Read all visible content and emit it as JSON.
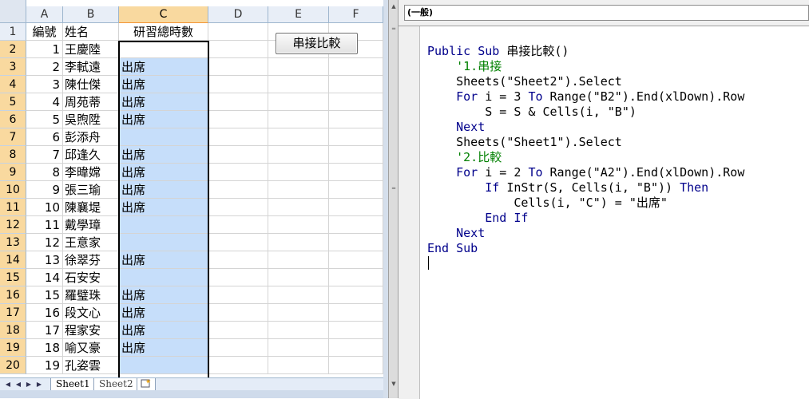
{
  "excel": {
    "columns": [
      "A",
      "B",
      "C",
      "D",
      "E",
      "F"
    ],
    "active_column": "C",
    "header_row": {
      "a": "編號",
      "b": "姓名",
      "c": "研習總時數"
    },
    "rows": [
      {
        "row": "2",
        "num": "1",
        "name": "王慶陸",
        "c": ""
      },
      {
        "row": "3",
        "num": "2",
        "name": "李軾遠",
        "c": "出席"
      },
      {
        "row": "4",
        "num": "3",
        "name": "陳仕傑",
        "c": "出席"
      },
      {
        "row": "5",
        "num": "4",
        "name": "周苑蒂",
        "c": "出席"
      },
      {
        "row": "6",
        "num": "5",
        "name": "吳煦陞",
        "c": "出席"
      },
      {
        "row": "7",
        "num": "6",
        "name": "彭添舟",
        "c": ""
      },
      {
        "row": "8",
        "num": "7",
        "name": "邱逢久",
        "c": "出席"
      },
      {
        "row": "9",
        "num": "8",
        "name": "李暐嫦",
        "c": "出席"
      },
      {
        "row": "10",
        "num": "9",
        "name": "張三瑜",
        "c": "出席"
      },
      {
        "row": "11",
        "num": "10",
        "name": "陳襄堤",
        "c": "出席"
      },
      {
        "row": "12",
        "num": "11",
        "name": "戴學璋",
        "c": ""
      },
      {
        "row": "13",
        "num": "12",
        "name": "王意家",
        "c": ""
      },
      {
        "row": "14",
        "num": "13",
        "name": "徐翠芬",
        "c": "出席"
      },
      {
        "row": "15",
        "num": "14",
        "name": "石安安",
        "c": ""
      },
      {
        "row": "16",
        "num": "15",
        "name": "羅璧珠",
        "c": "出席"
      },
      {
        "row": "17",
        "num": "16",
        "name": "段文心",
        "c": "出席"
      },
      {
        "row": "18",
        "num": "17",
        "name": "程家安",
        "c": "出席"
      },
      {
        "row": "19",
        "num": "18",
        "name": "喻又豪",
        "c": "出席"
      },
      {
        "row": "20",
        "num": "19",
        "name": "孔姿雲",
        "c": ""
      }
    ],
    "button_label": "串接比較",
    "sheet_tabs": [
      "Sheet1",
      "Sheet2"
    ],
    "selection_color": "#c6defa"
  },
  "vbe": {
    "procedure_selector": "(一般)",
    "code_lines": [
      [
        {
          "t": "kw",
          "s": "Public Sub"
        },
        {
          "t": "tx",
          "s": " 串接比較()"
        }
      ],
      [
        {
          "t": "cm",
          "s": "    '1.串接"
        }
      ],
      [
        {
          "t": "tx",
          "s": "    Sheets(\"Sheet2\").Select"
        }
      ],
      [
        {
          "t": "kw",
          "s": "    For"
        },
        {
          "t": "tx",
          "s": " i = 3 "
        },
        {
          "t": "kw",
          "s": "To"
        },
        {
          "t": "tx",
          "s": " Range(\"B2\").End(xlDown).Row"
        }
      ],
      [
        {
          "t": "tx",
          "s": "        S = S & Cells(i, \"B\")"
        }
      ],
      [
        {
          "t": "kw",
          "s": "    Next"
        }
      ],
      [
        {
          "t": "tx",
          "s": "    Sheets(\"Sheet1\").Select"
        }
      ],
      [
        {
          "t": "cm",
          "s": "    '2.比較"
        }
      ],
      [
        {
          "t": "kw",
          "s": "    For"
        },
        {
          "t": "tx",
          "s": " i = 2 "
        },
        {
          "t": "kw",
          "s": "To"
        },
        {
          "t": "tx",
          "s": " Range(\"A2\").End(xlDown).Row"
        }
      ],
      [
        {
          "t": "kw",
          "s": "        If"
        },
        {
          "t": "tx",
          "s": " InStr(S, Cells(i, \"B\")) "
        },
        {
          "t": "kw",
          "s": "Then"
        }
      ],
      [
        {
          "t": "tx",
          "s": "            Cells(i, \"C\") = \"出席\""
        }
      ],
      [
        {
          "t": "kw",
          "s": "        End If"
        }
      ],
      [
        {
          "t": "kw",
          "s": "    Next"
        }
      ],
      [
        {
          "t": "kw",
          "s": "End Sub"
        }
      ]
    ],
    "colors": {
      "keyword": "#00008b",
      "comment": "#008000",
      "text": "#000000"
    }
  }
}
